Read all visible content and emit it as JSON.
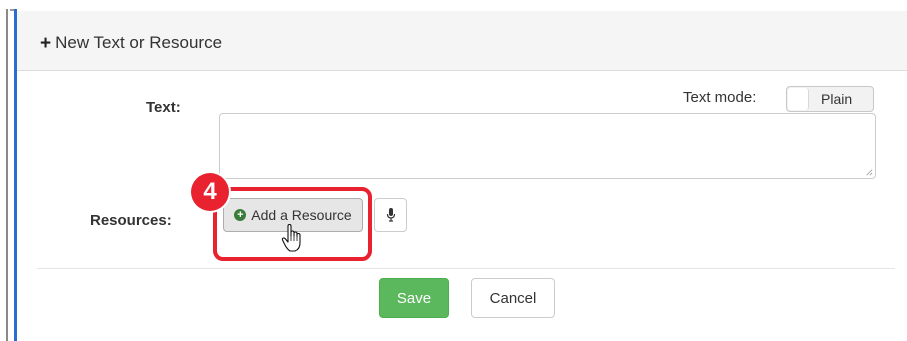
{
  "panel": {
    "title": "New Text or Resource",
    "title_icon": "plus-icon"
  },
  "form": {
    "text_label": "Text:",
    "text_mode_label": "Text mode:",
    "text_mode_value": "Plain",
    "text_value": "",
    "resources_label": "Resources:",
    "add_resource_label": "Add a Resource",
    "add_resource_icon": "plus-circle-icon",
    "mic_icon": "microphone-icon"
  },
  "annotation": {
    "step_number": "4",
    "color": "#e8222e"
  },
  "actions": {
    "save_label": "Save",
    "cancel_label": "Cancel"
  },
  "colors": {
    "accent_border": "#2d6bd0",
    "save": "#5cb85c"
  }
}
